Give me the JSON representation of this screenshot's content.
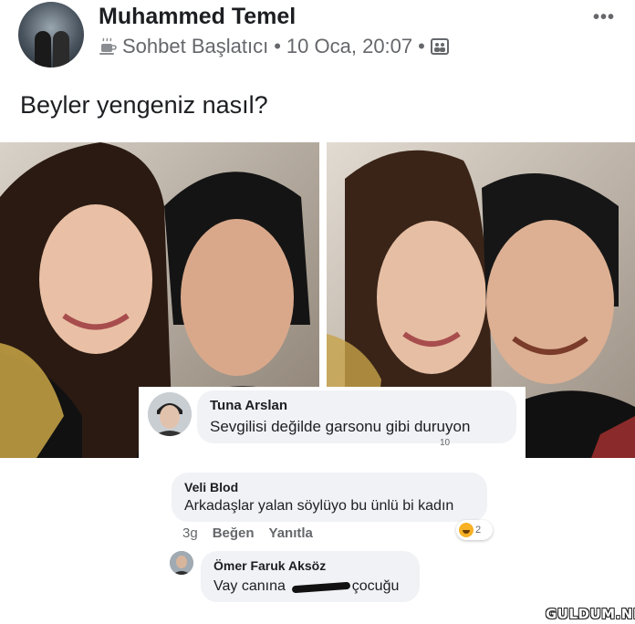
{
  "post": {
    "author": "Muhammed Temel",
    "badge": "Sohbet Başlatıcı",
    "separator": "•",
    "timestamp": "10 Oca, 20:07",
    "audience_icon": "group-icon",
    "more_icon": "•••",
    "text": "Beyler yengeniz nasıl?"
  },
  "photos": [
    {
      "name": "photo-left"
    },
    {
      "name": "photo-right"
    }
  ],
  "overlay_comment": {
    "author": "Tuna Arslan",
    "text": "Sevgilisi değilde garsonu gibi duruyon",
    "reactions_count": "10"
  },
  "comments": [
    {
      "author": "Veli Blod",
      "text": "Arkadaşlar yalan söylüyo bu ünlü bi kadın",
      "time": "3g",
      "like_label": "Beğen",
      "reply_label": "Yanıtla",
      "reaction_icon": "haha-icon",
      "reaction_count": "2"
    },
    {
      "author": "Ömer Faruk Aksöz",
      "text_before": "Vay canına",
      "text_after": "çocuğu"
    }
  ],
  "watermark": "GULDUM.NET"
}
